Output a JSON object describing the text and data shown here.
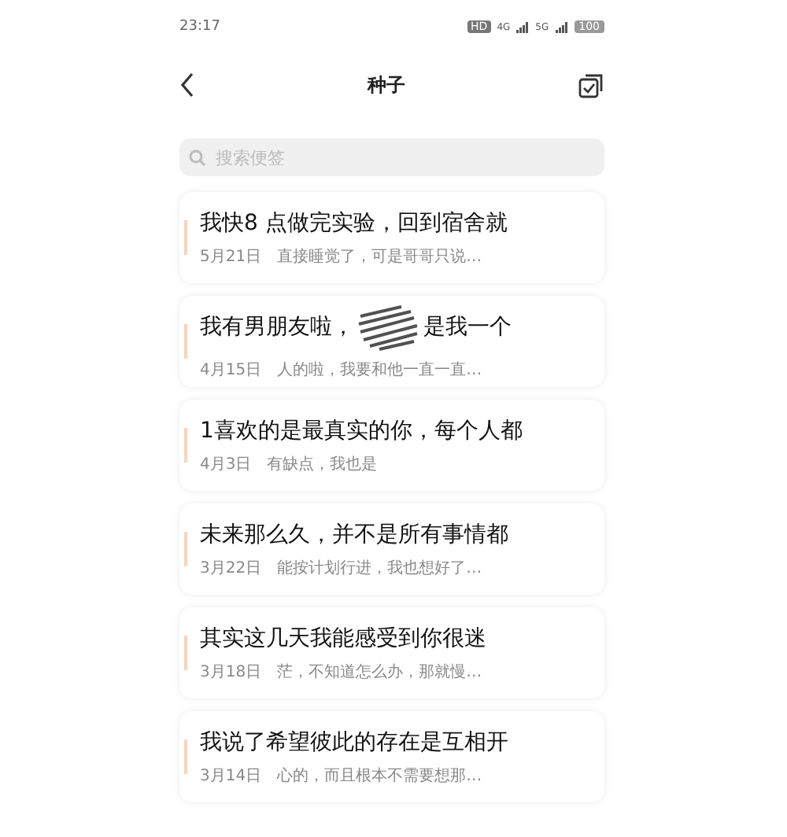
{
  "status_bar": {
    "time": "23:17",
    "hd": "HD",
    "networks": [
      "4G",
      "5G"
    ],
    "battery": "100"
  },
  "header": {
    "title": "种子"
  },
  "search": {
    "placeholder": "搜索便签"
  },
  "notes": [
    {
      "title": "我快8 点做完实验，回到宿舍就",
      "date": "5月21日",
      "preview": "直接睡觉了，可是哥哥只说…"
    },
    {
      "title": "我有男朋友啦，",
      "title_after": "是我一个",
      "redacted": true,
      "date": "4月15日",
      "preview": "人的啦，我要和他一直一直…"
    },
    {
      "title": "1喜欢的是最真实的你，每个人都",
      "date": "4月3日",
      "preview": "有缺点，我也是"
    },
    {
      "title": "未来那么久，并不是所有事情都",
      "date": "3月22日",
      "preview": "能按计划行进，我也想好了…"
    },
    {
      "title": "其实这几天我能感受到你很迷",
      "date": "3月18日",
      "preview": "茫，不知道怎么办，那就慢…"
    },
    {
      "title": "我说了希望彼此的存在是互相开",
      "date": "3月14日",
      "preview": "心的，而且根本不需要想那…"
    }
  ]
}
